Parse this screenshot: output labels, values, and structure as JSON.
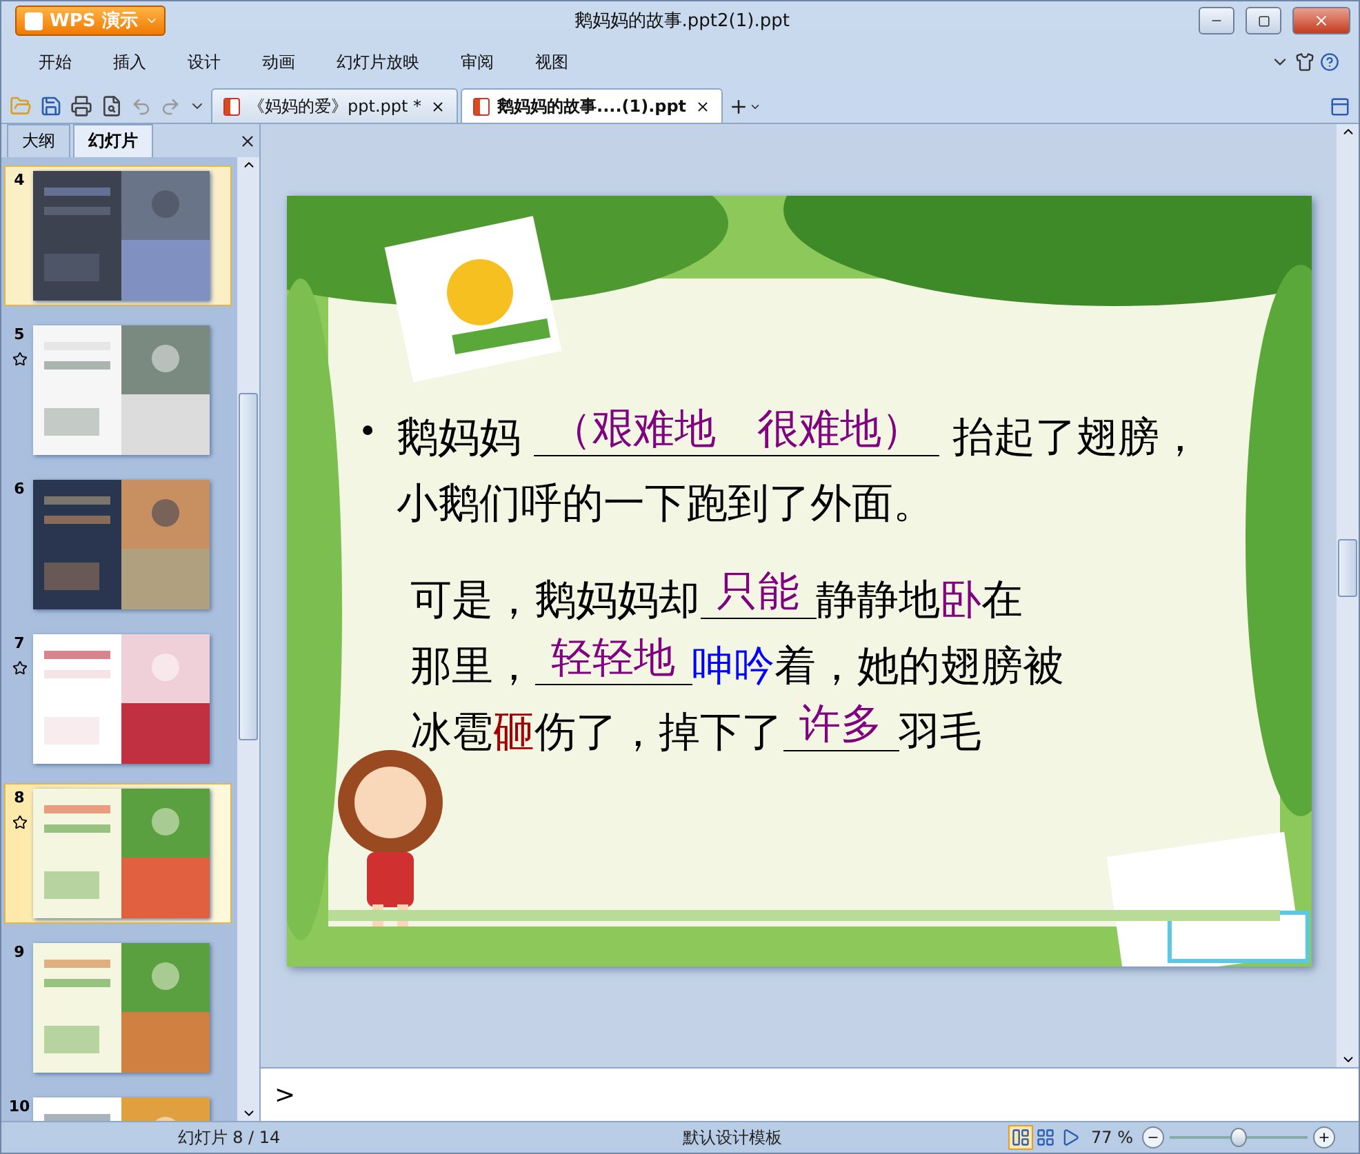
{
  "app_button": {
    "label": "WPS 演示"
  },
  "window": {
    "title": "鹅妈妈的故事.ppt2(1).ppt"
  },
  "menu": [
    {
      "label": "开始",
      "selected": false
    },
    {
      "label": "插入",
      "selected": false
    },
    {
      "label": "设计",
      "selected": false
    },
    {
      "label": "动画",
      "selected": false
    },
    {
      "label": "幻灯片放映",
      "selected": false
    },
    {
      "label": "审阅",
      "selected": false
    },
    {
      "label": "视图",
      "selected": false
    }
  ],
  "doc_tabs": [
    {
      "label": "《妈妈的爱》ppt.ppt *",
      "selected": false
    },
    {
      "label": "鹅妈妈的故事....(1).ppt",
      "selected": true
    }
  ],
  "side_tabs": [
    {
      "label": "大纲",
      "selected": false
    },
    {
      "label": "幻灯片",
      "selected": true
    }
  ],
  "thumbnails": [
    {
      "number": "4",
      "selected": false,
      "highlighted": true,
      "animated": false
    },
    {
      "number": "5",
      "selected": false,
      "highlighted": false,
      "animated": true
    },
    {
      "number": "6",
      "selected": false,
      "highlighted": false,
      "animated": false
    },
    {
      "number": "7",
      "selected": false,
      "highlighted": false,
      "animated": true
    },
    {
      "number": "8",
      "selected": true,
      "highlighted": true,
      "animated": true
    },
    {
      "number": "9",
      "selected": false,
      "highlighted": false,
      "animated": false
    },
    {
      "number": "10",
      "selected": false,
      "highlighted": false,
      "animated": false
    }
  ],
  "slide": {
    "paragraphs": [
      {
        "bullet": "•",
        "lines": [
          [
            {
              "kind": "plain",
              "text": "鹅妈妈 "
            },
            {
              "kind": "blank",
              "text": "（艰难地　很难地）"
            },
            {
              "kind": "plain",
              "text": " 抬起了翅膀，"
            }
          ],
          [
            {
              "kind": "plain",
              "text": "小鹅们呼的一下跑到了外面。"
            }
          ]
        ]
      },
      {
        "lines": [
          [
            {
              "kind": "plain",
              "text": "可是，鹅妈妈却"
            },
            {
              "kind": "blank",
              "text": "只能"
            },
            {
              "kind": "plain",
              "text": "静静地"
            },
            {
              "kind": "colored",
              "text": "卧",
              "color": "#800080"
            },
            {
              "kind": "plain",
              "text": "在"
            }
          ],
          [
            {
              "kind": "plain",
              "text": "那里，"
            },
            {
              "kind": "blank",
              "text": "轻轻地"
            },
            {
              "kind": "colored",
              "text": "呻吟",
              "color": "#0000ff"
            },
            {
              "kind": "plain",
              "text": "着，她的翅膀被"
            }
          ],
          [
            {
              "kind": "plain",
              "text": "冰雹"
            },
            {
              "kind": "colored",
              "text": "砸",
              "color": "#a00000"
            },
            {
              "kind": "plain",
              "text": "伤了，掉下了"
            },
            {
              "kind": "blank",
              "text": "许多"
            },
            {
              "kind": "plain",
              "text": "羽毛"
            }
          ]
        ]
      }
    ]
  },
  "notes": {
    "prompt": ">"
  },
  "status_bar": {
    "slide_count": "幻灯片 8 / 14",
    "template": "默认设计模板",
    "zoom": "77 %",
    "zoom_level": {
      "level": 0.5
    }
  }
}
